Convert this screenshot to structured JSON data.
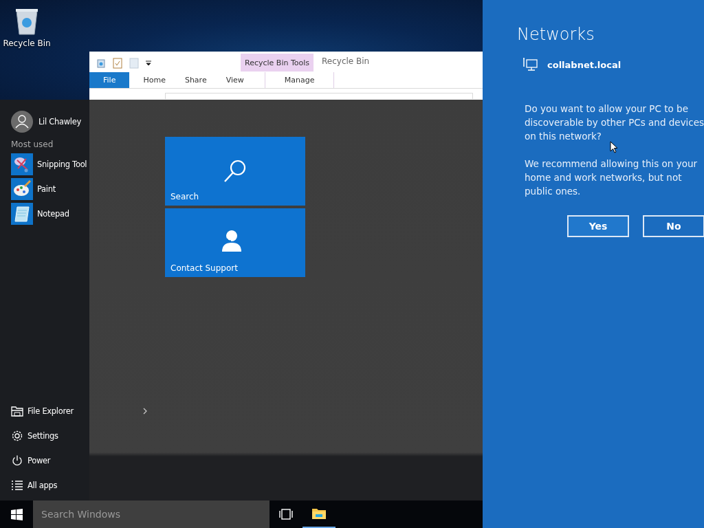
{
  "desktop": {
    "icons": [
      {
        "label": "Recycle Bin",
        "kind": "recycle_bin"
      }
    ]
  },
  "explorer": {
    "context_group": "Recycle Bin Tools",
    "title": "Recycle Bin",
    "tabs": [
      {
        "label": "File",
        "kind": "file"
      },
      {
        "label": "Home",
        "kind": "normal"
      },
      {
        "label": "Share",
        "kind": "normal"
      },
      {
        "label": "View",
        "kind": "normal"
      },
      {
        "label": "Manage",
        "kind": "contextual"
      }
    ]
  },
  "start_menu": {
    "user": {
      "name": "Lil Chawley"
    },
    "most_used_heading": "Most used",
    "most_used": [
      {
        "label": "Snipping Tool",
        "kind": "snipping"
      },
      {
        "label": "Paint",
        "kind": "paint"
      },
      {
        "label": "Notepad",
        "kind": "notepad"
      }
    ],
    "places": [
      {
        "label": "File Explorer",
        "kind": "explorer",
        "submenu": true
      },
      {
        "label": "Settings",
        "kind": "settings",
        "submenu": false
      },
      {
        "label": "Power",
        "kind": "power",
        "submenu": false
      },
      {
        "label": "All apps",
        "kind": "all_apps",
        "submenu": false
      }
    ],
    "tiles": [
      {
        "label": "Search",
        "kind": "search"
      },
      {
        "label": "Contact Support",
        "kind": "support"
      }
    ]
  },
  "taskbar": {
    "search": {
      "placeholder": "Search Windows"
    },
    "apps": [
      {
        "kind": "task_view",
        "running": false
      },
      {
        "kind": "file_explorer",
        "running": true
      }
    ]
  },
  "network_flyout": {
    "title": "Networks",
    "network": "collabnet.local",
    "paragraphs": [
      "Do you want to allow your PC to be discoverable by other PCs and devices on this network?",
      "We recommend allowing this on your home and work networks, but not public ones."
    ],
    "buttons": [
      {
        "label": "Yes",
        "focused": true
      },
      {
        "label": "No",
        "focused": false
      }
    ]
  }
}
